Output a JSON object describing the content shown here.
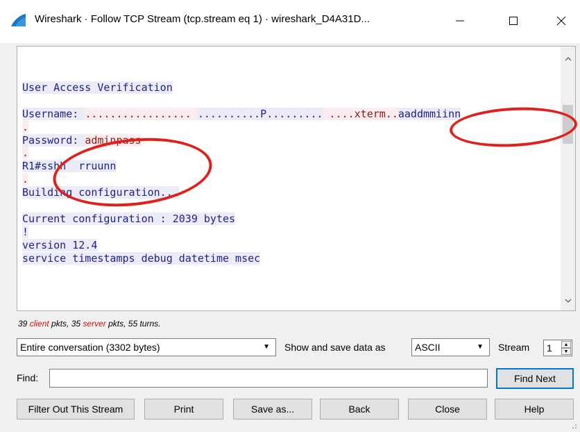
{
  "window": {
    "title": "Wireshark · Follow TCP Stream (tcp.stream eq 1) · wireshark_D4A31D...",
    "controls": [
      "minimize",
      "maximize",
      "close"
    ]
  },
  "stream": {
    "lines": [
      {
        "segments": [
          {
            "text": "User Access Verification",
            "dir": "client"
          }
        ]
      },
      {
        "segments": []
      },
      {
        "segments": [
          {
            "text": "Username: ",
            "dir": "client"
          },
          {
            "text": "................. ",
            "dir": "server"
          },
          {
            "text": "..........P.........",
            "dir": "client"
          },
          {
            "text": " ....xterm..",
            "dir": "server"
          },
          {
            "text": "aaddmmiinn",
            "dir": "client"
          }
        ]
      },
      {
        "segments": [
          {
            "text": ".",
            "dir": "server"
          }
        ]
      },
      {
        "segments": [
          {
            "text": "Password: ",
            "dir": "client"
          },
          {
            "text": "adminpass",
            "dir": "server"
          }
        ]
      },
      {
        "segments": [
          {
            "text": ".",
            "dir": "server"
          }
        ]
      },
      {
        "segments": [
          {
            "text": "R1#",
            "dir": "client"
          },
          {
            "text": "sshh  rruunn",
            "dir": "client"
          }
        ]
      },
      {
        "segments": [
          {
            "text": ".",
            "dir": "server"
          }
        ]
      },
      {
        "segments": [
          {
            "text": "Building configuration...",
            "dir": "client"
          }
        ]
      },
      {
        "segments": []
      },
      {
        "segments": [
          {
            "text": "Current configuration : 2039 bytes",
            "dir": "client"
          }
        ]
      },
      {
        "segments": [
          {
            "text": "!",
            "dir": "client"
          }
        ]
      },
      {
        "segments": [
          {
            "text": "version 12.4",
            "dir": "client"
          }
        ]
      },
      {
        "segments": [
          {
            "text": "service timestamps debug datetime msec",
            "dir": "client"
          }
        ]
      }
    ]
  },
  "stats": {
    "client_count": "39",
    "client_word": "client",
    "mid_text": " pkts, 35 ",
    "server_word": "server",
    "tail_text": " pkts, 55 turns."
  },
  "controls": {
    "conversation_value": "Entire conversation (3302 bytes)",
    "show_save_label": "Show and save data as",
    "format_value": "ASCII",
    "stream_label": "Stream",
    "stream_value": "1",
    "find_label": "Find:",
    "find_value": "",
    "find_next_label": "Find Next"
  },
  "buttons": {
    "filter_out": "Filter Out This Stream",
    "print": "Print",
    "save_as": "Save as...",
    "back": "Back",
    "close": "Close",
    "help": "Help"
  },
  "colors": {
    "client_text": "#1e1e8c",
    "client_bg": "#ececf8",
    "server_text": "#8b1a1a",
    "server_bg": "#fbeded",
    "annotation_ring": "#e0201c",
    "accent": "#0078d7"
  },
  "annotations": [
    "red-ring-around-username",
    "red-ring-around-password"
  ]
}
